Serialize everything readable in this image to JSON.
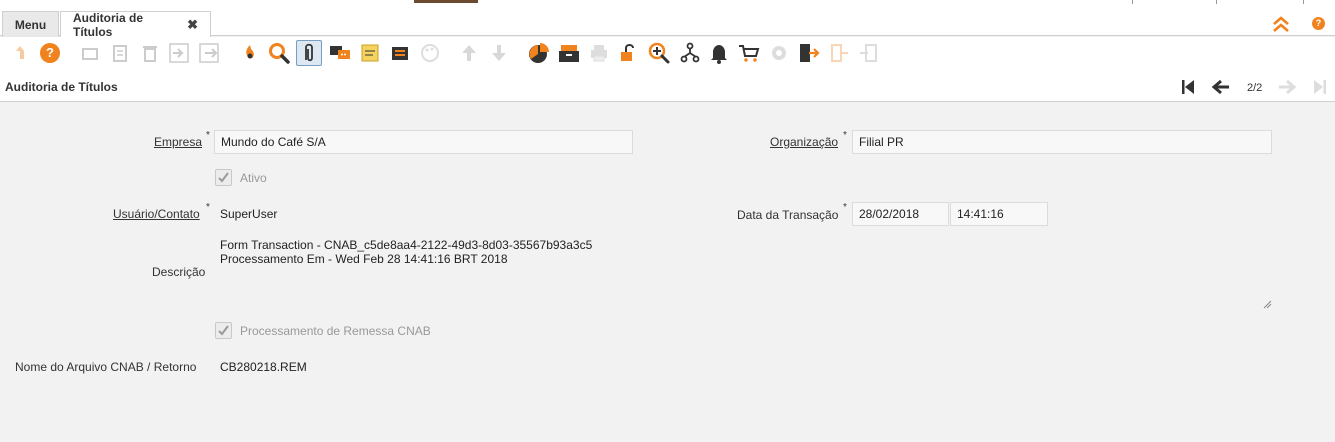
{
  "tabs": {
    "menu_label": "Menu",
    "active_label": "Auditoria de Títulos",
    "close_glyph": "✖"
  },
  "top_right": {
    "collapse_icon": "double-chevron-up-icon",
    "help_label": "?"
  },
  "toolbar": {
    "help_label": "?",
    "icons": [
      "undo-icon",
      "help-icon",
      "new-record-icon",
      "copy-record-icon",
      "delete-icon",
      "import-icon",
      "export-icon",
      "refresh-icon",
      "find-icon",
      "attachment-icon",
      "chat-icon",
      "notes-icon",
      "archive-icon",
      "palette-icon",
      "parent-record-icon",
      "detail-record-icon",
      "report-icon",
      "archived-documents-icon",
      "print-icon",
      "lock-icon",
      "zoom-across-icon",
      "workflow-icon",
      "alert-icon",
      "cart-icon",
      "settings-icon",
      "exit-icon",
      "import-disabled-icon",
      "export-disabled-icon"
    ]
  },
  "titlebar": {
    "title": "Auditoria de Títulos",
    "record_count": "2/2"
  },
  "form": {
    "empresa_label": "Empresa",
    "empresa_value": "Mundo do Café S/A",
    "organizacao_label": "Organização",
    "organizacao_value": "Filial PR",
    "ativo_label": "Ativo",
    "usuario_label": "Usuário/Contato",
    "usuario_value": "SuperUser",
    "data_label": "Data da Transação",
    "data_date": "28/02/2018",
    "data_time": "14:41:16",
    "descricao_label": "Descrição",
    "descricao_line1": "Form Transaction - CNAB_c5de8aa4-2122-49d3-8d03-35567b93a3c5",
    "descricao_line2": "Processamento Em - Wed Feb 28 14:41:16 BRT 2018",
    "processamento_label": "Processamento de Remessa CNAB",
    "arquivo_label": "Nome do Arquivo CNAB / Retorno",
    "arquivo_value": "CB280218.REM",
    "required_mark": "*"
  },
  "colors": {
    "accent": "#f0831e",
    "dark": "#333333"
  }
}
